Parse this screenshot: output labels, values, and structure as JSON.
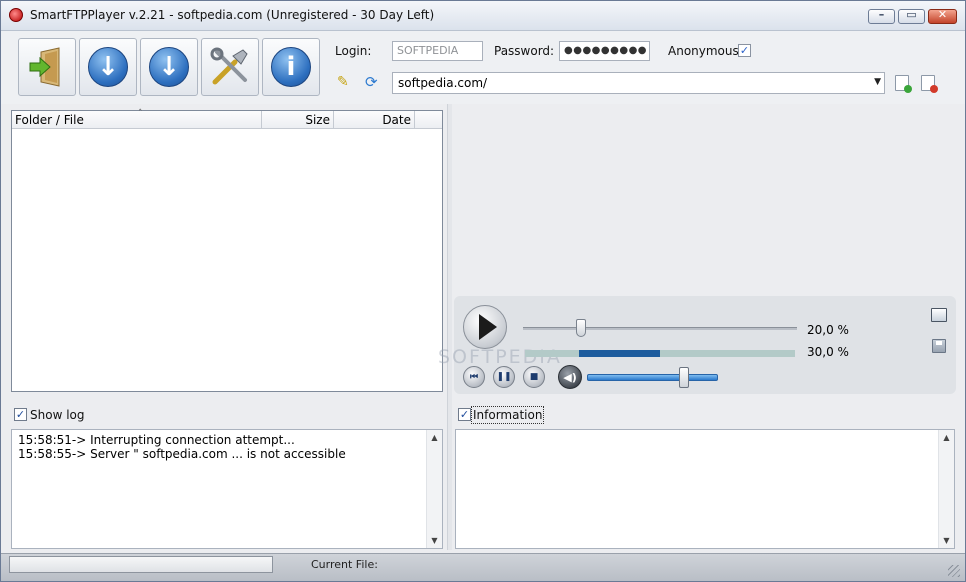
{
  "window": {
    "title": "SmartFTPPlayer v.2.21 - softpedia.com (Unregistered - 30 Day Left)",
    "min_glyph": "–",
    "max_glyph": "▭",
    "close_glyph": "✕"
  },
  "toolbar": {
    "buttons": [
      {
        "name": "connect",
        "icon": "door-exit-icon"
      },
      {
        "name": "download",
        "icon": "arrow-down-icon",
        "glyph": "↓"
      },
      {
        "name": "download-queue",
        "icon": "arrow-down-icon",
        "glyph": "↓"
      },
      {
        "name": "settings",
        "icon": "tools-icon",
        "glyph": "✗"
      },
      {
        "name": "info",
        "icon": "info-icon",
        "glyph": "i"
      }
    ]
  },
  "connection": {
    "login_label": "Login:",
    "login_value": "SOFTPEDIA",
    "password_label": "Password:",
    "password_value": "●●●●●●●●●",
    "anonymous_label": "Anonymous",
    "anonymous_checked": true,
    "checkmark": "✓",
    "url": "softpedia.com/",
    "url_arrow": "▼"
  },
  "file_list": {
    "columns": [
      "Folder / File",
      "Size",
      "Date"
    ],
    "sort_marker": "ˆ",
    "rows": []
  },
  "log": {
    "show_log_label": "Show log",
    "show_log_checked": true,
    "lines": [
      "15:58:51-> Interrupting connection attempt...",
      "15:58:55-> Server \" softpedia.com ... is not accessible"
    ]
  },
  "player": {
    "position_percent": 20,
    "position_text": "20,0 %",
    "buffer_percent": 30,
    "buffer_text": "30,0 %",
    "volume_percent": 75,
    "prev_glyph": "⏮",
    "pause_glyph": "❚❚",
    "stop_glyph": "■",
    "volume_glyph": "◀)",
    "colors": {
      "buffer_fill": "#1d5c9e",
      "buffer_track": "#b3cac8",
      "volume": "#2b79cc"
    }
  },
  "info": {
    "label": "Information",
    "checked": true
  },
  "watermark": "SOFTPEDIA",
  "status": {
    "current_file_label": "Current File:"
  }
}
